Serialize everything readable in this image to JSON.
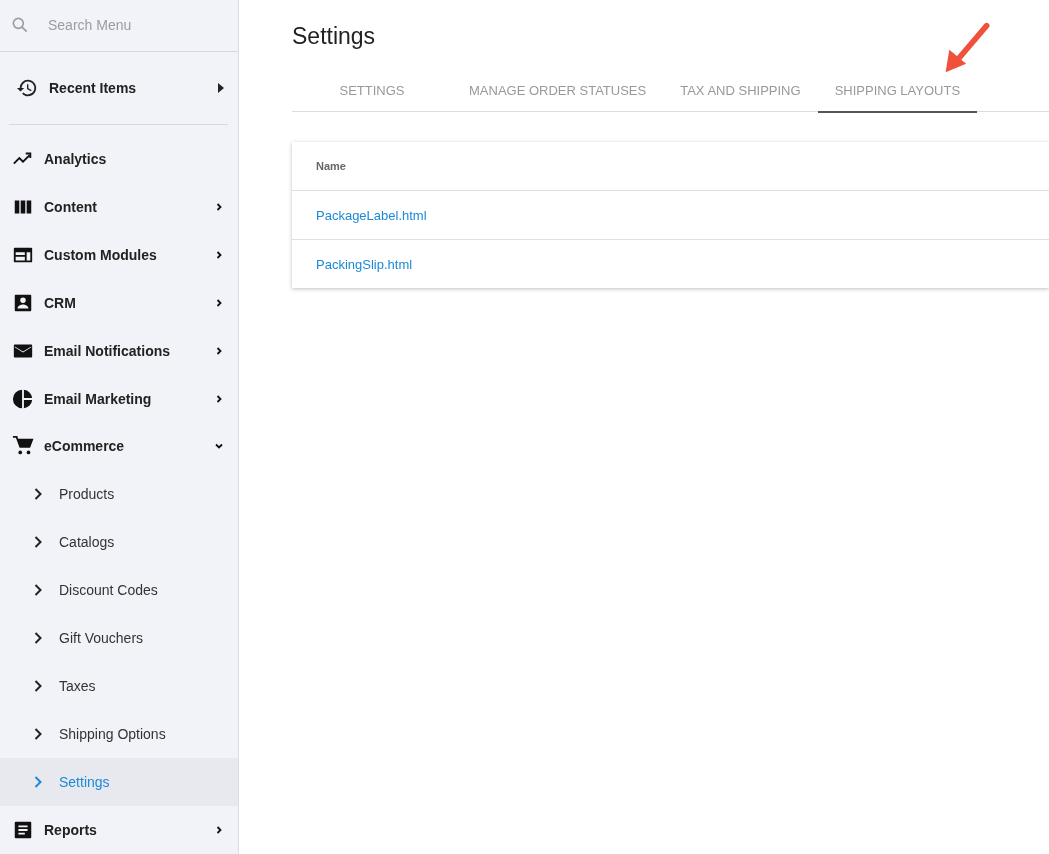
{
  "sidebar": {
    "search": {
      "placeholder": "Search Menu"
    },
    "recent": {
      "label": "Recent Items"
    },
    "items": [
      {
        "label": "Analytics",
        "kind": "link"
      },
      {
        "label": "Content",
        "kind": "group",
        "expanded": false
      },
      {
        "label": "Custom Modules",
        "kind": "group",
        "expanded": false
      },
      {
        "label": "CRM",
        "kind": "group",
        "expanded": false
      },
      {
        "label": "Email Notifications",
        "kind": "group",
        "expanded": false
      },
      {
        "label": "Email Marketing",
        "kind": "group",
        "expanded": false
      },
      {
        "label": "eCommerce",
        "kind": "group",
        "expanded": true,
        "children": [
          {
            "label": "Products",
            "selected": false
          },
          {
            "label": "Catalogs",
            "selected": false
          },
          {
            "label": "Discount Codes",
            "selected": false
          },
          {
            "label": "Gift Vouchers",
            "selected": false
          },
          {
            "label": "Taxes",
            "selected": false
          },
          {
            "label": "Shipping Options",
            "selected": false
          },
          {
            "label": "Settings",
            "selected": true
          }
        ]
      },
      {
        "label": "Reports",
        "kind": "group",
        "expanded": false
      }
    ]
  },
  "page": {
    "title": "Settings",
    "tabs": [
      {
        "label": "SETTINGS",
        "selected": false
      },
      {
        "label": "MANAGE ORDER STATUSES",
        "selected": false
      },
      {
        "label": "TAX AND SHIPPING",
        "selected": false
      },
      {
        "label": "SHIPPING LAYOUTS",
        "selected": true
      }
    ],
    "table": {
      "columns": [
        "Name"
      ],
      "rows": [
        {
          "name": "PackageLabel.html"
        },
        {
          "name": "PackingSlip.html"
        }
      ]
    }
  }
}
